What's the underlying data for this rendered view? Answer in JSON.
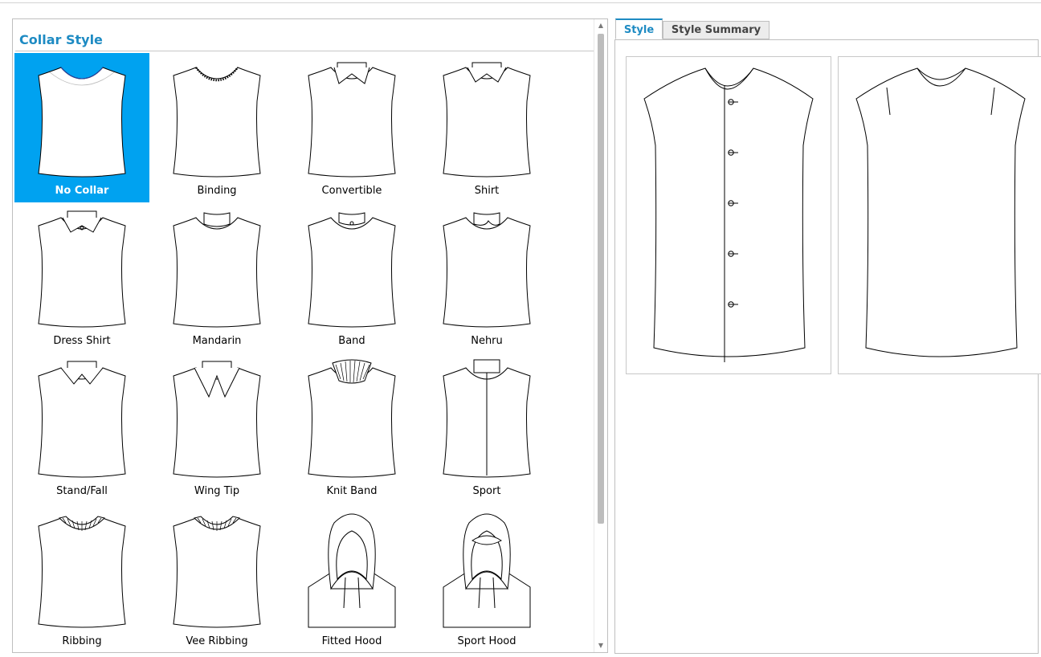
{
  "panel": {
    "title": "Collar Style"
  },
  "collars": [
    {
      "label": "No Collar",
      "icon": "no-collar",
      "selected": true
    },
    {
      "label": "Binding",
      "icon": "binding",
      "selected": false
    },
    {
      "label": "Convertible",
      "icon": "convertible",
      "selected": false
    },
    {
      "label": "Shirt",
      "icon": "shirt",
      "selected": false
    },
    {
      "label": "Dress Shirt",
      "icon": "dress-shirt",
      "selected": false
    },
    {
      "label": "Mandarin",
      "icon": "mandarin",
      "selected": false
    },
    {
      "label": "Band",
      "icon": "band",
      "selected": false
    },
    {
      "label": "Nehru",
      "icon": "nehru",
      "selected": false
    },
    {
      "label": "Stand/Fall",
      "icon": "stand-fall",
      "selected": false
    },
    {
      "label": "Wing Tip",
      "icon": "wing-tip",
      "selected": false
    },
    {
      "label": "Knit Band",
      "icon": "knit-band",
      "selected": false
    },
    {
      "label": "Sport",
      "icon": "sport",
      "selected": false
    },
    {
      "label": "Ribbing",
      "icon": "ribbing",
      "selected": false
    },
    {
      "label": "Vee Ribbing",
      "icon": "vee-ribbing",
      "selected": false
    },
    {
      "label": "Fitted Hood",
      "icon": "fitted-hood",
      "selected": false
    },
    {
      "label": "Sport Hood",
      "icon": "sport-hood",
      "selected": false
    }
  ],
  "tabs": {
    "style": "Style",
    "summary": "Style Summary"
  },
  "preview": {
    "front_buttons": 5
  },
  "colors": {
    "selected": "#00a2f0",
    "accent": "#1e8bc3"
  }
}
